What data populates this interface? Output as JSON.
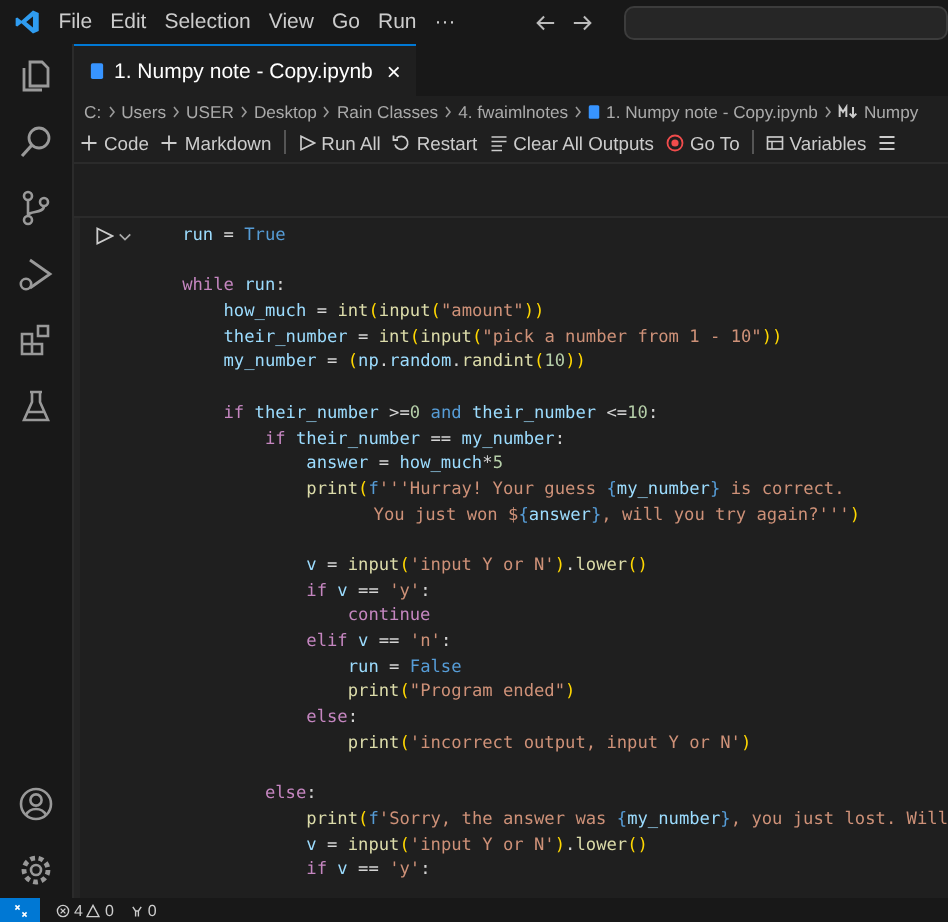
{
  "menu": [
    "File",
    "Edit",
    "Selection",
    "View",
    "Go",
    "Run",
    "···"
  ],
  "tab": {
    "title": "1. Numpy note - Copy.ipynb",
    "close": "×",
    "selected": true
  },
  "breadcrumb": [
    {
      "kind": "text",
      "text": "C:"
    },
    {
      "kind": "text",
      "text": "Users"
    },
    {
      "kind": "text",
      "text": "USER"
    },
    {
      "kind": "text",
      "text": "Desktop"
    },
    {
      "kind": "text",
      "text": "Rain Classes"
    },
    {
      "kind": "text",
      "text": "4. fwaimlnotes"
    },
    {
      "kind": "notebook",
      "text": "1. Numpy note - Copy.ipynb"
    },
    {
      "kind": "markdown",
      "text": "Numpy"
    }
  ],
  "toolbar": [
    {
      "kind": "plus",
      "label": "Code"
    },
    {
      "kind": "plus",
      "label": "Markdown"
    },
    {
      "kind": "sep"
    },
    {
      "kind": "run",
      "label": "Run All"
    },
    {
      "kind": "restart",
      "label": "Restart"
    },
    {
      "kind": "clear",
      "label": "Clear All Outputs"
    },
    {
      "kind": "goto",
      "label": "Go To"
    },
    {
      "kind": "sep"
    },
    {
      "kind": "variables",
      "label": "Variables"
    },
    {
      "kind": "outline"
    }
  ],
  "code": [
    {
      "tokens": [
        {
          "kind": "var",
          "text": "run"
        },
        {
          "kind": "op",
          "text": " = "
        },
        {
          "kind": "const",
          "text": "True"
        }
      ]
    },
    {
      "blank_line_before": true,
      "tokens": [
        {
          "kind": "kw",
          "text": "while "
        },
        {
          "kind": "var",
          "text": "run"
        },
        {
          "kind": "op",
          "text": ":"
        }
      ],
      "children": [
        {
          "tokens": [
            {
              "kind": "var",
              "text": "how_much"
            },
            {
              "kind": "op",
              "text": " = "
            },
            {
              "kind": "fn",
              "text": "int"
            },
            {
              "kind": "br",
              "text": "("
            },
            {
              "kind": "fn",
              "text": "input"
            },
            {
              "kind": "br",
              "text": "("
            },
            {
              "kind": "str",
              "text": "\"amount\""
            },
            {
              "kind": "br",
              "text": "))"
            }
          ]
        },
        {
          "tokens": [
            {
              "kind": "var",
              "text": "their_number"
            },
            {
              "kind": "op",
              "text": " = "
            },
            {
              "kind": "fn",
              "text": "int"
            },
            {
              "kind": "br",
              "text": "("
            },
            {
              "kind": "fn",
              "text": "input"
            },
            {
              "kind": "br",
              "text": "("
            },
            {
              "kind": "str",
              "text": "\"pick a number from 1 - 10\""
            },
            {
              "kind": "br",
              "text": "))"
            }
          ]
        },
        {
          "tokens": [
            {
              "kind": "var",
              "text": "my_number"
            },
            {
              "kind": "op",
              "text": " = "
            },
            {
              "kind": "br",
              "text": "("
            },
            {
              "kind": "var",
              "text": "np"
            },
            {
              "kind": "op",
              "text": "."
            },
            {
              "kind": "var",
              "text": "random"
            },
            {
              "kind": "op",
              "text": "."
            },
            {
              "kind": "fn",
              "text": "randint"
            },
            {
              "kind": "br",
              "text": "("
            },
            {
              "kind": "num",
              "text": "10"
            },
            {
              "kind": "br",
              "text": "))"
            }
          ]
        },
        {
          "blank_line_before": true,
          "tokens": [
            {
              "kind": "kw",
              "text": "if "
            },
            {
              "kind": "var",
              "text": "their_number"
            },
            {
              "kind": "op",
              "text": " >="
            },
            {
              "kind": "num",
              "text": "0"
            },
            {
              "kind": "const",
              "text": " and "
            },
            {
              "kind": "var",
              "text": "their_number"
            },
            {
              "kind": "op",
              "text": " <="
            },
            {
              "kind": "num",
              "text": "10"
            },
            {
              "kind": "op",
              "text": ":"
            }
          ],
          "children": [
            {
              "tokens": [
                {
                  "kind": "kw",
                  "text": "if "
                },
                {
                  "kind": "var",
                  "text": "their_number"
                },
                {
                  "kind": "op",
                  "text": " == "
                },
                {
                  "kind": "var",
                  "text": "my_number"
                },
                {
                  "kind": "op",
                  "text": ":"
                }
              ],
              "children": [
                {
                  "tokens": [
                    {
                      "kind": "var",
                      "text": "answer"
                    },
                    {
                      "kind": "op",
                      "text": " = "
                    },
                    {
                      "kind": "var",
                      "text": "how_much"
                    },
                    {
                      "kind": "op",
                      "text": "*"
                    },
                    {
                      "kind": "num",
                      "text": "5"
                    }
                  ]
                },
                {
                  "tokens": [
                    {
                      "kind": "fn",
                      "text": "print"
                    },
                    {
                      "kind": "br",
                      "text": "("
                    },
                    {
                      "kind": "const",
                      "text": "f"
                    },
                    {
                      "kind": "str",
                      "text": "'''Hurray! Your guess "
                    },
                    {
                      "kind": "const",
                      "text": "{"
                    },
                    {
                      "kind": "var",
                      "text": "my_number"
                    },
                    {
                      "kind": "const",
                      "text": "}"
                    },
                    {
                      "kind": "str",
                      "text": " is correct."
                    }
                  ],
                  "children": [
                    {
                      "kind": "continuation",
                      "tokens": [
                        {
                          "kind": "str",
                          "text": "You just won $"
                        },
                        {
                          "kind": "const",
                          "text": "{"
                        },
                        {
                          "kind": "var",
                          "text": "answer"
                        },
                        {
                          "kind": "const",
                          "text": "}"
                        },
                        {
                          "kind": "str",
                          "text": ", will you try again?'''"
                        },
                        {
                          "kind": "br",
                          "text": ")"
                        }
                      ]
                    }
                  ]
                },
                {
                  "blank_line_before": true,
                  "tokens": [
                    {
                      "kind": "var",
                      "text": "v"
                    },
                    {
                      "kind": "op",
                      "text": " = "
                    },
                    {
                      "kind": "fn",
                      "text": "input"
                    },
                    {
                      "kind": "br",
                      "text": "("
                    },
                    {
                      "kind": "str",
                      "text": "'input Y or N'"
                    },
                    {
                      "kind": "br",
                      "text": ")"
                    },
                    {
                      "kind": "op",
                      "text": "."
                    },
                    {
                      "kind": "fn",
                      "text": "lower"
                    },
                    {
                      "kind": "br",
                      "text": "()"
                    }
                  ]
                },
                {
                  "tokens": [
                    {
                      "kind": "kw",
                      "text": "if "
                    },
                    {
                      "kind": "var",
                      "text": "v"
                    },
                    {
                      "kind": "op",
                      "text": " == "
                    },
                    {
                      "kind": "str",
                      "text": "'y'"
                    },
                    {
                      "kind": "op",
                      "text": ":"
                    }
                  ],
                  "children": [
                    {
                      "tokens": [
                        {
                          "kind": "kw",
                          "text": "continue"
                        }
                      ]
                    }
                  ]
                },
                {
                  "tokens": [
                    {
                      "kind": "kw",
                      "text": "elif "
                    },
                    {
                      "kind": "var",
                      "text": "v"
                    },
                    {
                      "kind": "op",
                      "text": " == "
                    },
                    {
                      "kind": "str",
                      "text": "'n'"
                    },
                    {
                      "kind": "op",
                      "text": ":"
                    }
                  ],
                  "children": [
                    {
                      "tokens": [
                        {
                          "kind": "var",
                          "text": "run"
                        },
                        {
                          "kind": "op",
                          "text": " = "
                        },
                        {
                          "kind": "const",
                          "text": "False"
                        }
                      ]
                    },
                    {
                      "tokens": [
                        {
                          "kind": "fn",
                          "text": "print"
                        },
                        {
                          "kind": "br",
                          "text": "("
                        },
                        {
                          "kind": "str",
                          "text": "\"Program ended\""
                        },
                        {
                          "kind": "br",
                          "text": ")"
                        }
                      ]
                    }
                  ]
                },
                {
                  "tokens": [
                    {
                      "kind": "kw",
                      "text": "else"
                    },
                    {
                      "kind": "op",
                      "text": ":"
                    }
                  ],
                  "children": [
                    {
                      "tokens": [
                        {
                          "kind": "fn",
                          "text": "print"
                        },
                        {
                          "kind": "br",
                          "text": "("
                        },
                        {
                          "kind": "str",
                          "text": "'incorrect output, input Y or N'"
                        },
                        {
                          "kind": "br",
                          "text": ")"
                        }
                      ]
                    }
                  ]
                }
              ]
            },
            {
              "blank_line_before": true,
              "tokens": [
                {
                  "kind": "kw",
                  "text": "else"
                },
                {
                  "kind": "op",
                  "text": ":"
                }
              ],
              "children": [
                {
                  "tokens": [
                    {
                      "kind": "fn",
                      "text": "print"
                    },
                    {
                      "kind": "br",
                      "text": "("
                    },
                    {
                      "kind": "const",
                      "text": "f"
                    },
                    {
                      "kind": "str",
                      "text": "'Sorry, the answer was "
                    },
                    {
                      "kind": "const",
                      "text": "{"
                    },
                    {
                      "kind": "var",
                      "text": "my_number"
                    },
                    {
                      "kind": "const",
                      "text": "}"
                    },
                    {
                      "kind": "str",
                      "text": ", you just lost. Will"
                    }
                  ]
                },
                {
                  "tokens": [
                    {
                      "kind": "var",
                      "text": "v"
                    },
                    {
                      "kind": "op",
                      "text": " = "
                    },
                    {
                      "kind": "fn",
                      "text": "input"
                    },
                    {
                      "kind": "br",
                      "text": "("
                    },
                    {
                      "kind": "str",
                      "text": "'input Y or N'"
                    },
                    {
                      "kind": "br",
                      "text": ")"
                    },
                    {
                      "kind": "op",
                      "text": "."
                    },
                    {
                      "kind": "fn",
                      "text": "lower"
                    },
                    {
                      "kind": "br",
                      "text": "()"
                    }
                  ]
                },
                {
                  "tokens": [
                    {
                      "kind": "kw",
                      "text": "if "
                    },
                    {
                      "kind": "var",
                      "text": "v"
                    },
                    {
                      "kind": "op",
                      "text": " == "
                    },
                    {
                      "kind": "str",
                      "text": "'y'"
                    },
                    {
                      "kind": "op",
                      "text": ":"
                    }
                  ]
                }
              ]
            }
          ]
        }
      ]
    }
  ],
  "status": {
    "errors": "4",
    "warnings": "0",
    "ports": "0"
  }
}
